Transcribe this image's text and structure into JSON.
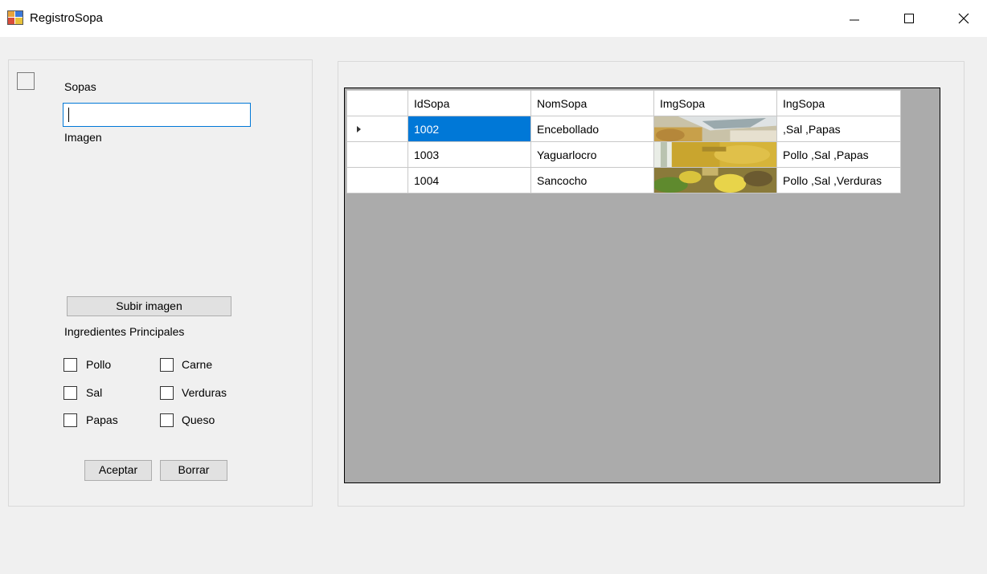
{
  "window": {
    "title": "RegistroSopa",
    "minimize_icon": "minimize-icon",
    "maximize_icon": "maximize-icon",
    "close_icon": "close-icon"
  },
  "form": {
    "sopas_label": "Sopas",
    "sopas_input_value": "",
    "imagen_label": "Imagen",
    "upload_button": "Subir imagen",
    "ingredients_label": "Ingredientes Principales",
    "checkboxes": [
      {
        "label": "Pollo",
        "checked": false
      },
      {
        "label": "Carne",
        "checked": false
      },
      {
        "label": "Sal",
        "checked": false
      },
      {
        "label": "Verduras",
        "checked": false
      },
      {
        "label": "Papas",
        "checked": false
      },
      {
        "label": "Queso",
        "checked": false
      }
    ],
    "accept_button": "Aceptar",
    "delete_button": "Borrar"
  },
  "grid": {
    "columns": [
      "IdSopa",
      "NomSopa",
      "ImgSopa",
      "IngSopa"
    ],
    "rows": [
      {
        "id": "1002",
        "name": "Encebollado",
        "img": "soup-thumbnail",
        "ing": ",Sal ,Papas",
        "current": true
      },
      {
        "id": "1003",
        "name": "Yaguarlocro",
        "img": "soup-thumbnail",
        "ing": "Pollo ,Sal ,Papas",
        "current": false
      },
      {
        "id": "1004",
        "name": "Sancocho",
        "img": "soup-thumbnail",
        "ing": "Pollo ,Sal ,Verduras",
        "current": false
      }
    ],
    "colors": {
      "selection": "#0078d7",
      "background": "#ababab"
    }
  }
}
